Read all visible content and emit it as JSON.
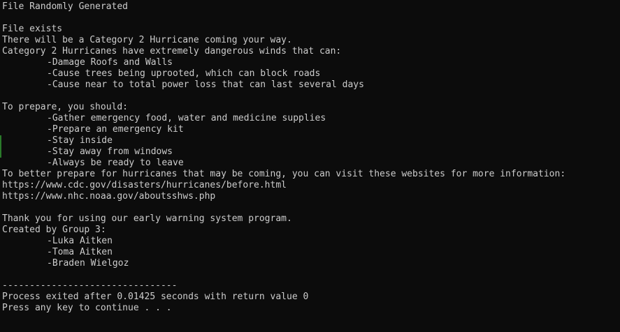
{
  "console": {
    "lines": [
      {
        "text": "File Randomly Generated",
        "indent": false
      },
      {
        "text": "",
        "indent": false
      },
      {
        "text": "File exists",
        "indent": false
      },
      {
        "text": "There will be a Category 2 Hurricane coming your way.",
        "indent": false
      },
      {
        "text": "Category 2 Hurricanes have extremely dangerous winds that can:",
        "indent": false
      },
      {
        "text": "-Damage Roofs and Walls",
        "indent": true
      },
      {
        "text": "-Cause trees being uprooted, which can block roads",
        "indent": true
      },
      {
        "text": "-Cause near to total power loss that can last several days",
        "indent": true
      },
      {
        "text": "",
        "indent": false
      },
      {
        "text": "To prepare, you should:",
        "indent": false
      },
      {
        "text": "-Gather emergency food, water and medicine supplies",
        "indent": true
      },
      {
        "text": "-Prepare an emergency kit",
        "indent": true
      },
      {
        "text": "-Stay inside",
        "indent": true
      },
      {
        "text": "-Stay away from windows",
        "indent": true
      },
      {
        "text": "-Always be ready to leave",
        "indent": true
      },
      {
        "text": "To better prepare for hurricanes that may be coming, you can visit these websites for more information:",
        "indent": false
      },
      {
        "text": "https://www.cdc.gov/disasters/hurricanes/before.html",
        "indent": false
      },
      {
        "text": "https://www.nhc.noaa.gov/aboutsshws.php",
        "indent": false
      },
      {
        "text": "",
        "indent": false
      },
      {
        "text": "Thank you for using our early warning system program.",
        "indent": false
      },
      {
        "text": "Created by Group 3:",
        "indent": false
      },
      {
        "text": "-Luka Aitken",
        "indent": true
      },
      {
        "text": "-Toma Aitken",
        "indent": true
      },
      {
        "text": "-Braden Wielgoz",
        "indent": true
      },
      {
        "text": "",
        "indent": false
      },
      {
        "text": "--------------------------------",
        "indent": false
      },
      {
        "text": "Process exited after 0.01425 seconds with return value 0",
        "indent": false
      },
      {
        "text": "Press any key to continue . . .",
        "indent": false
      }
    ]
  },
  "colors": {
    "background": "#0c0c0c",
    "text": "#cccccc"
  }
}
